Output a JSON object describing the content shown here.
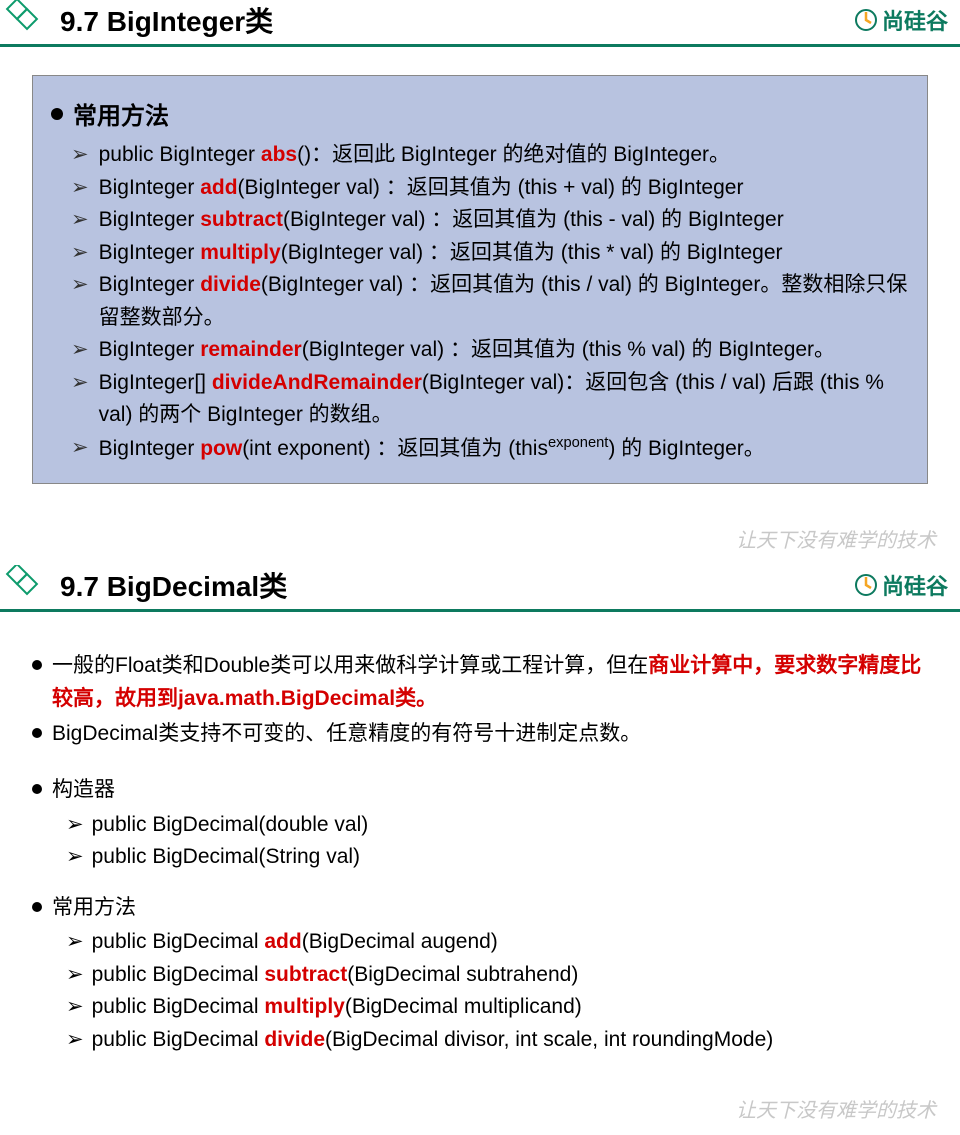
{
  "brand": {
    "name": "尚硅谷"
  },
  "watermark": "让天下没有难学的技术",
  "slides": [
    {
      "title": "9.7 BigInteger类",
      "box_heading": "常用方法",
      "methods": [
        {
          "pre": "public BigInteger ",
          "kw": "abs",
          "post": "()：返回此 BigInteger 的绝对值的 BigInteger。"
        },
        {
          "pre": "BigInteger ",
          "kw": "add",
          "post": "(BigInteger val) ：返回其值为 (this + val) 的 BigInteger"
        },
        {
          "pre": "BigInteger ",
          "kw": "subtract",
          "post": "(BigInteger val) ：返回其值为 (this - val) 的 BigInteger"
        },
        {
          "pre": "BigInteger ",
          "kw": "multiply",
          "post": "(BigInteger val) ：返回其值为 (this * val) 的 BigInteger"
        },
        {
          "pre": "BigInteger ",
          "kw": "divide",
          "post": "(BigInteger val) ：返回其值为 (this / val) 的 BigInteger。整数相除只保留整数部分。"
        },
        {
          "pre": "BigInteger ",
          "kw": "remainder",
          "post": "(BigInteger val) ：返回其值为 (this % val) 的 BigInteger。"
        },
        {
          "pre": "BigInteger[] ",
          "kw": "divideAndRemainder",
          "post": "(BigInteger val)：返回包含 (this / val) 后跟 (this % val) 的两个 BigInteger 的数组。"
        },
        {
          "pre": "BigInteger ",
          "kw": "pow",
          "post_html": "(int exponent) ：返回其值为 (this<sup>exponent</sup>) 的 BigInteger。"
        }
      ]
    },
    {
      "title": "9.7 BigDecimal类",
      "intro": [
        {
          "pre": "一般的Float类和Double类可以用来做科学计算或工程计算，但在",
          "red": "商业计算中，要求数字精度比较高，故用到java.math.BigDecimal类。",
          "post": ""
        },
        {
          "pre": "BigDecimal类支持不可变的、任意精度的有符号十进制定点数。",
          "red": "",
          "post": ""
        }
      ],
      "constructor_heading": "构造器",
      "constructors": [
        "public BigDecimal(double val)",
        "public BigDecimal(String val)"
      ],
      "methods_heading": "常用方法",
      "methods": [
        {
          "pre": "public BigDecimal ",
          "kw": "add",
          "post": "(BigDecimal augend)"
        },
        {
          "pre": "public BigDecimal ",
          "kw": "subtract",
          "post": "(BigDecimal subtrahend)"
        },
        {
          "pre": "public BigDecimal ",
          "kw": "multiply",
          "post": "(BigDecimal multiplicand)"
        },
        {
          "pre": "public BigDecimal ",
          "kw": "divide",
          "post": "(BigDecimal divisor, int scale, int roundingMode)"
        }
      ]
    }
  ]
}
